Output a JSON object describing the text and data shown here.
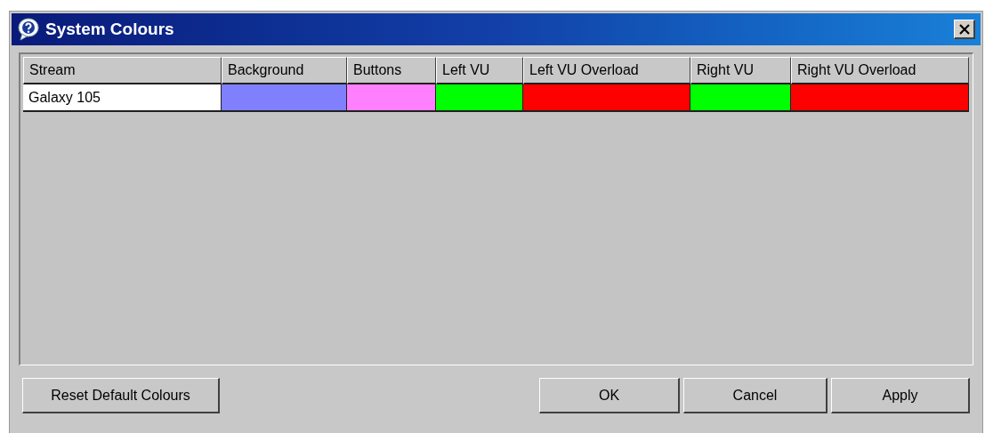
{
  "window": {
    "title": "System Colours"
  },
  "table": {
    "columns": [
      "Stream",
      "Background",
      "Buttons",
      "Left VU",
      "Left VU Overload",
      "Right VU",
      "Right VU Overload"
    ],
    "rows": [
      {
        "stream": "Galaxy 105",
        "cells": [
          {
            "color": "#8080ff"
          },
          {
            "color": "#ff80ff"
          },
          {
            "color": "#00ff00"
          },
          {
            "color": "#ff0000"
          },
          {
            "color": "#00ff00"
          },
          {
            "color": "#ff0000"
          }
        ]
      }
    ]
  },
  "buttons": {
    "reset": "Reset Default Colours",
    "actions": [
      "OK",
      "Cancel",
      "Apply"
    ]
  }
}
